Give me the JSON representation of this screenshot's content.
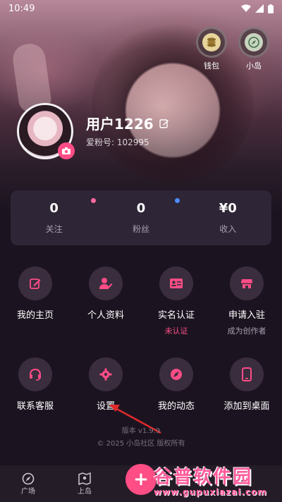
{
  "status_bar": {
    "time": "10:49"
  },
  "top_buttons": [
    {
      "label": "钱包",
      "icon": "coins-icon"
    },
    {
      "label": "小岛",
      "icon": "compass-icon"
    }
  ],
  "profile": {
    "username": "用户1226",
    "fan_id": "爱粉号: 102995"
  },
  "stats": [
    {
      "value": "0",
      "label": "关注"
    },
    {
      "value": "0",
      "label": "粉丝"
    },
    {
      "value": "¥0",
      "label": "收入"
    }
  ],
  "menu": [
    {
      "label": "我的主页",
      "icon": "edit-icon"
    },
    {
      "label": "个人资料",
      "icon": "user-edit-icon"
    },
    {
      "label": "实名认证",
      "icon": "id-card-icon",
      "sub": "未认证",
      "sub_color": "#ff4d86"
    },
    {
      "label": "申请入驻",
      "icon": "store-icon",
      "sub": "成为创作者",
      "sub_color": "#a99fb0"
    },
    {
      "label": "联系客服",
      "icon": "headset-icon"
    },
    {
      "label": "设置",
      "icon": "gear-icon"
    },
    {
      "label": "我的动态",
      "icon": "compass-icon"
    },
    {
      "label": "添加到桌面",
      "icon": "phone-icon"
    }
  ],
  "footer": {
    "version": "版本 v1.9.9",
    "copyright": "© 2025 小岛社区 版权所有"
  },
  "tabbar": [
    {
      "label": "广场",
      "icon": "compass-icon"
    },
    {
      "label": "上岛",
      "icon": "map-icon"
    }
  ],
  "fab_label": "+",
  "watermark": {
    "title": "谷普软件园",
    "url": "www.gupuxiazai.com"
  },
  "colors": {
    "accent": "#ff4d86",
    "tile_bg": "#3a2d3e",
    "card_bg": "#2e2536"
  }
}
